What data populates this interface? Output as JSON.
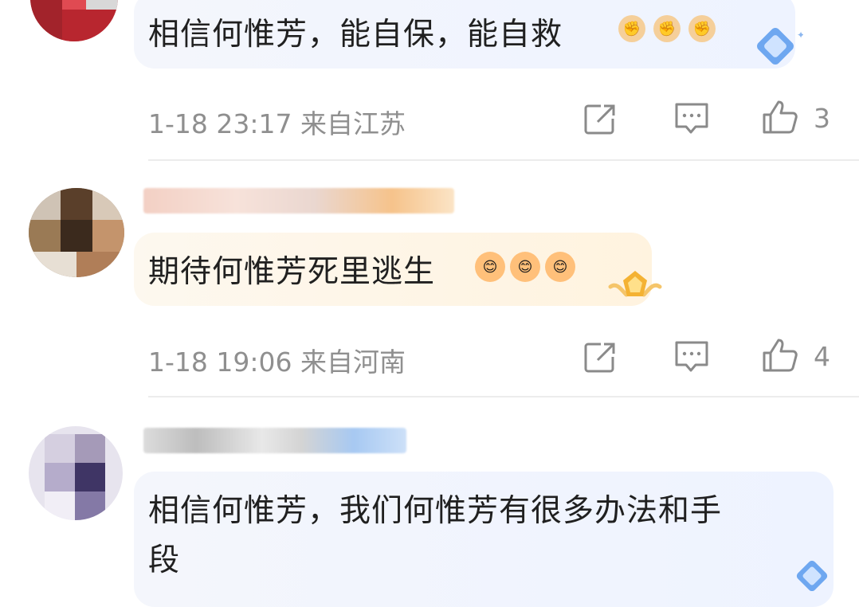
{
  "comments": [
    {
      "text": "相信何惟芳，能自保，能自救",
      "time": "1-18 23:17",
      "location": "来自江苏",
      "likes": "3",
      "emoji_count": 3
    },
    {
      "text": "期待何惟芳死里逃生",
      "time": "1-18 19:06",
      "location": "来自河南",
      "likes": "4",
      "emoji_count": 3
    },
    {
      "text_line1": "相信何惟芳，我们何惟芳有很多办法和手",
      "text_line2": "段"
    }
  ],
  "icons": {
    "share": "share-icon",
    "comment": "comment-icon",
    "like": "thumbs-up-icon",
    "badge_blue": "diamond-badge-icon",
    "badge_gold": "gold-badge-icon"
  },
  "colors": {
    "meta_text": "#8f8f8f",
    "bubble_blue": "#eef3ff",
    "bubble_gold": "#fff3df"
  }
}
